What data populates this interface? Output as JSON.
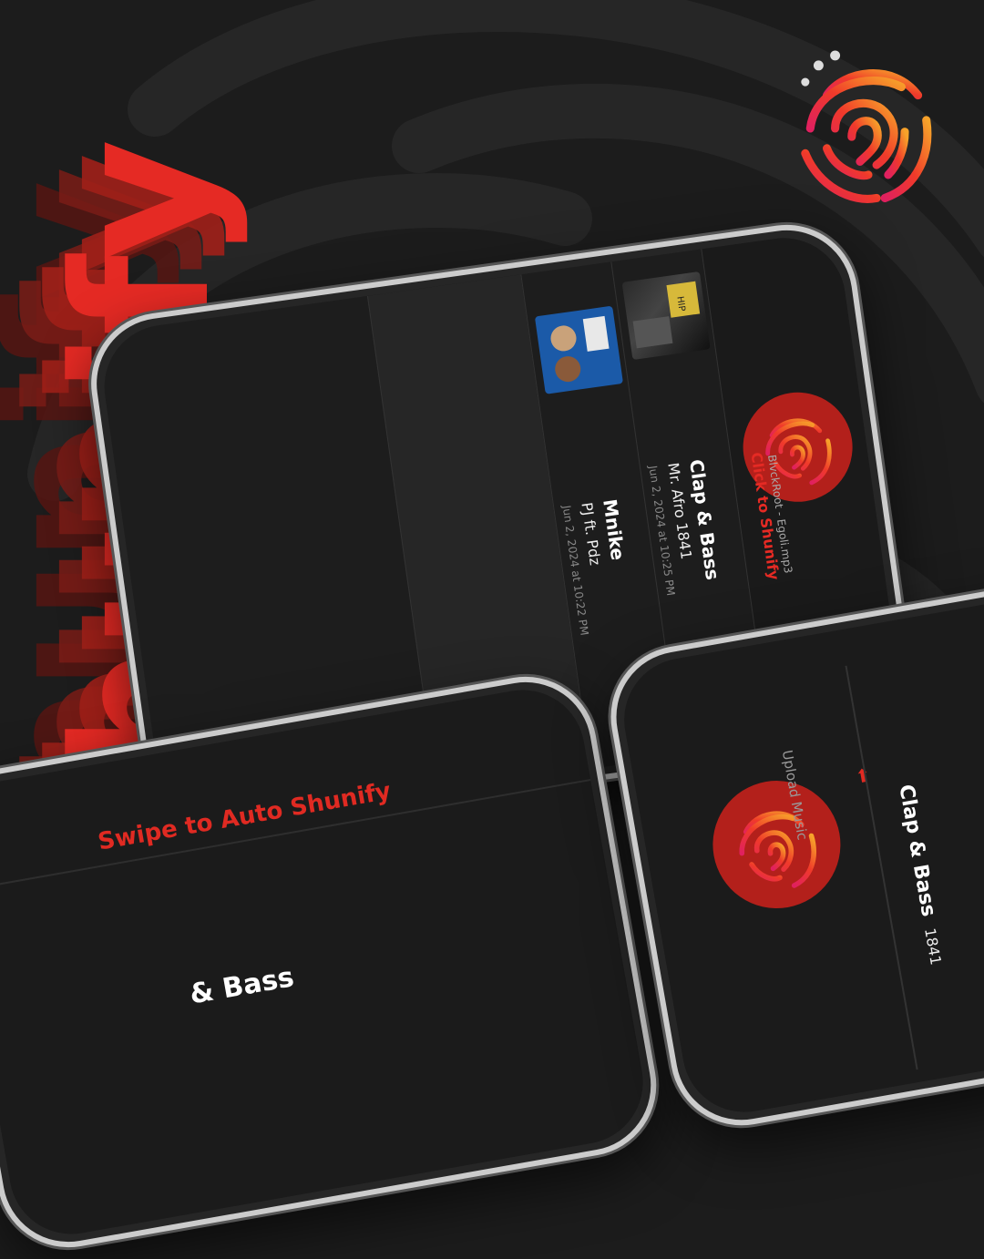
{
  "brand": {
    "name": "Shunify",
    "accent": "#e52a24",
    "background": "#1c1c1c"
  },
  "phone_main": {
    "now_scanning": {
      "file": "BlvckRoot - Egoli.mp3",
      "cta": "Click to Shunify"
    },
    "history": [
      {
        "title": "Clap & Bass",
        "artist": "Mr. Afro 1841",
        "date": "Jun 2, 2024 at 10:25 PM",
        "cover_icon": "album-cover-clap-bass"
      },
      {
        "title": "Mnike",
        "artist": "PJ ft. Pdz",
        "date": "Jun 2, 2024 at 10:22 PM",
        "cover_icon": "album-cover-mnike"
      }
    ]
  },
  "phone_left": {
    "swipe_hint": "Swipe to Auto Shunify",
    "track_title": "& Bass"
  },
  "phone_right": {
    "upload_label": "Upload Music",
    "upload_icon": "upload-icon",
    "track_title": "Clap & Bass",
    "track_artist": "1841"
  }
}
